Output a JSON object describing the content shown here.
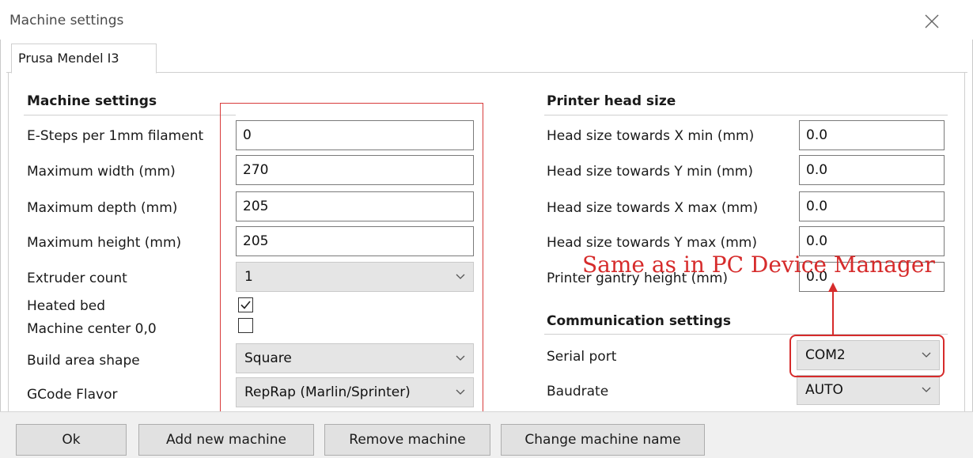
{
  "window": {
    "title": "Machine settings",
    "close_icon": "close-icon"
  },
  "tabs": [
    {
      "label": "Prusa Mendel I3",
      "active": true
    }
  ],
  "machine": {
    "section_title": "Machine settings",
    "esteps": {
      "label": "E-Steps per 1mm filament",
      "value": "0"
    },
    "width": {
      "label": "Maximum width (mm)",
      "value": "270"
    },
    "depth": {
      "label": "Maximum depth (mm)",
      "value": "205"
    },
    "height": {
      "label": "Maximum height (mm)",
      "value": "205"
    },
    "extruder": {
      "label": "Extruder count",
      "value": "1"
    },
    "heated_bed": {
      "label": "Heated bed",
      "checked": true
    },
    "center": {
      "label": "Machine center 0,0",
      "checked": false
    },
    "build_shape": {
      "label": "Build area shape",
      "value": "Square"
    },
    "gcode": {
      "label": "GCode Flavor",
      "value": "RepRap (Marlin/Sprinter)"
    }
  },
  "printhead": {
    "section_title": "Printer head size",
    "x_min": {
      "label": "Head size towards X min (mm)",
      "value": "0.0"
    },
    "y_min": {
      "label": "Head size towards Y min (mm)",
      "value": "0.0"
    },
    "x_max": {
      "label": "Head size towards X max (mm)",
      "value": "0.0"
    },
    "y_max": {
      "label": "Head size towards Y max (mm)",
      "value": "0.0"
    },
    "gantry": {
      "label": "Printer gantry height (mm)",
      "value": "0.0"
    }
  },
  "communication": {
    "section_title": "Communication settings",
    "serial": {
      "label": "Serial port",
      "value": "COM2"
    },
    "baud": {
      "label": "Baudrate",
      "value": "AUTO"
    }
  },
  "annotation": {
    "text": "Same as in PC Device Manager",
    "color": "#d62b2b"
  },
  "footer": {
    "ok": "Ok",
    "add": "Add new machine",
    "remove": "Remove machine",
    "rename": "Change machine name"
  },
  "colors": {
    "accent_red": "#d62b2b",
    "select_bg": "#e5e5e5",
    "footer_bg": "#f0f0f0"
  }
}
